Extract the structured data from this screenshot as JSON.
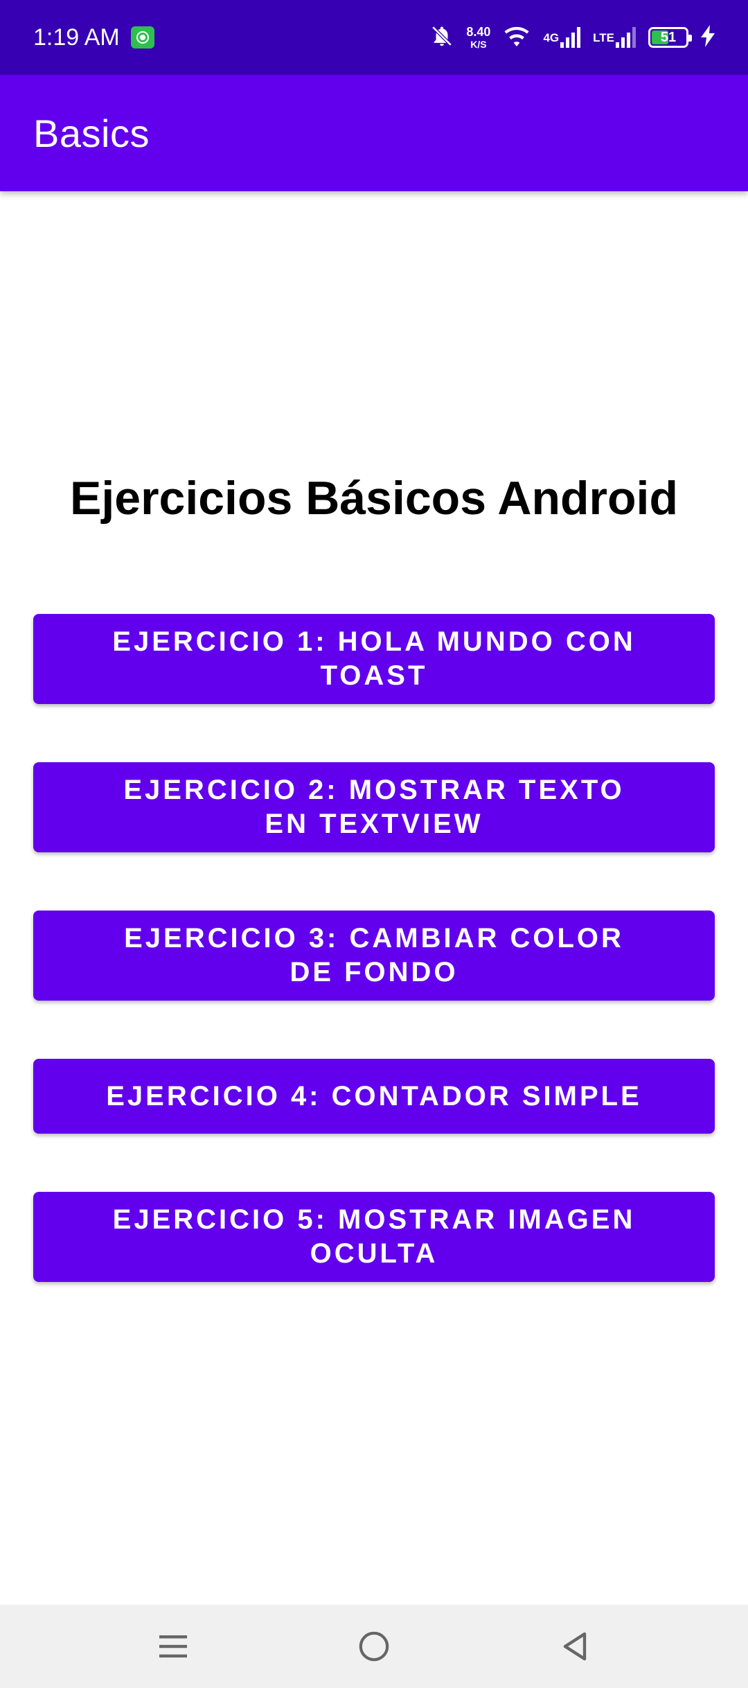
{
  "status_bar": {
    "time": "1:19 AM",
    "speed_value": "8.40",
    "speed_unit": "K/S",
    "network_1": "4G",
    "network_2": "LTE",
    "battery_level": "51",
    "icons": [
      "app-notification-icon",
      "bell-off-icon",
      "wifi-icon",
      "signal-icon",
      "signal-icon",
      "battery-icon",
      "charging-bolt-icon"
    ]
  },
  "app_bar": {
    "title": "Basics"
  },
  "main": {
    "heading": "Ejercicios Básicos Android",
    "buttons": [
      {
        "label": "EJERCICIO 1: HOLA MUNDO CON TOAST"
      },
      {
        "label": "EJERCICIO 2: MOSTRAR TEXTO EN TEXTVIEW"
      },
      {
        "label": "EJERCICIO 3: CAMBIAR COLOR DE FONDO"
      },
      {
        "label": "EJERCICIO 4: CONTADOR SIMPLE"
      },
      {
        "label": "EJERCICIO 5: MOSTRAR IMAGEN OCULTA"
      }
    ]
  },
  "nav_bar": {
    "icons": [
      "menu-icon",
      "home-icon",
      "back-icon"
    ]
  },
  "colors": {
    "status_bar": "#3700b3",
    "primary": "#6200ee",
    "nav_bar": "#f0f0f0",
    "battery_fill": "#2fbf4f"
  }
}
